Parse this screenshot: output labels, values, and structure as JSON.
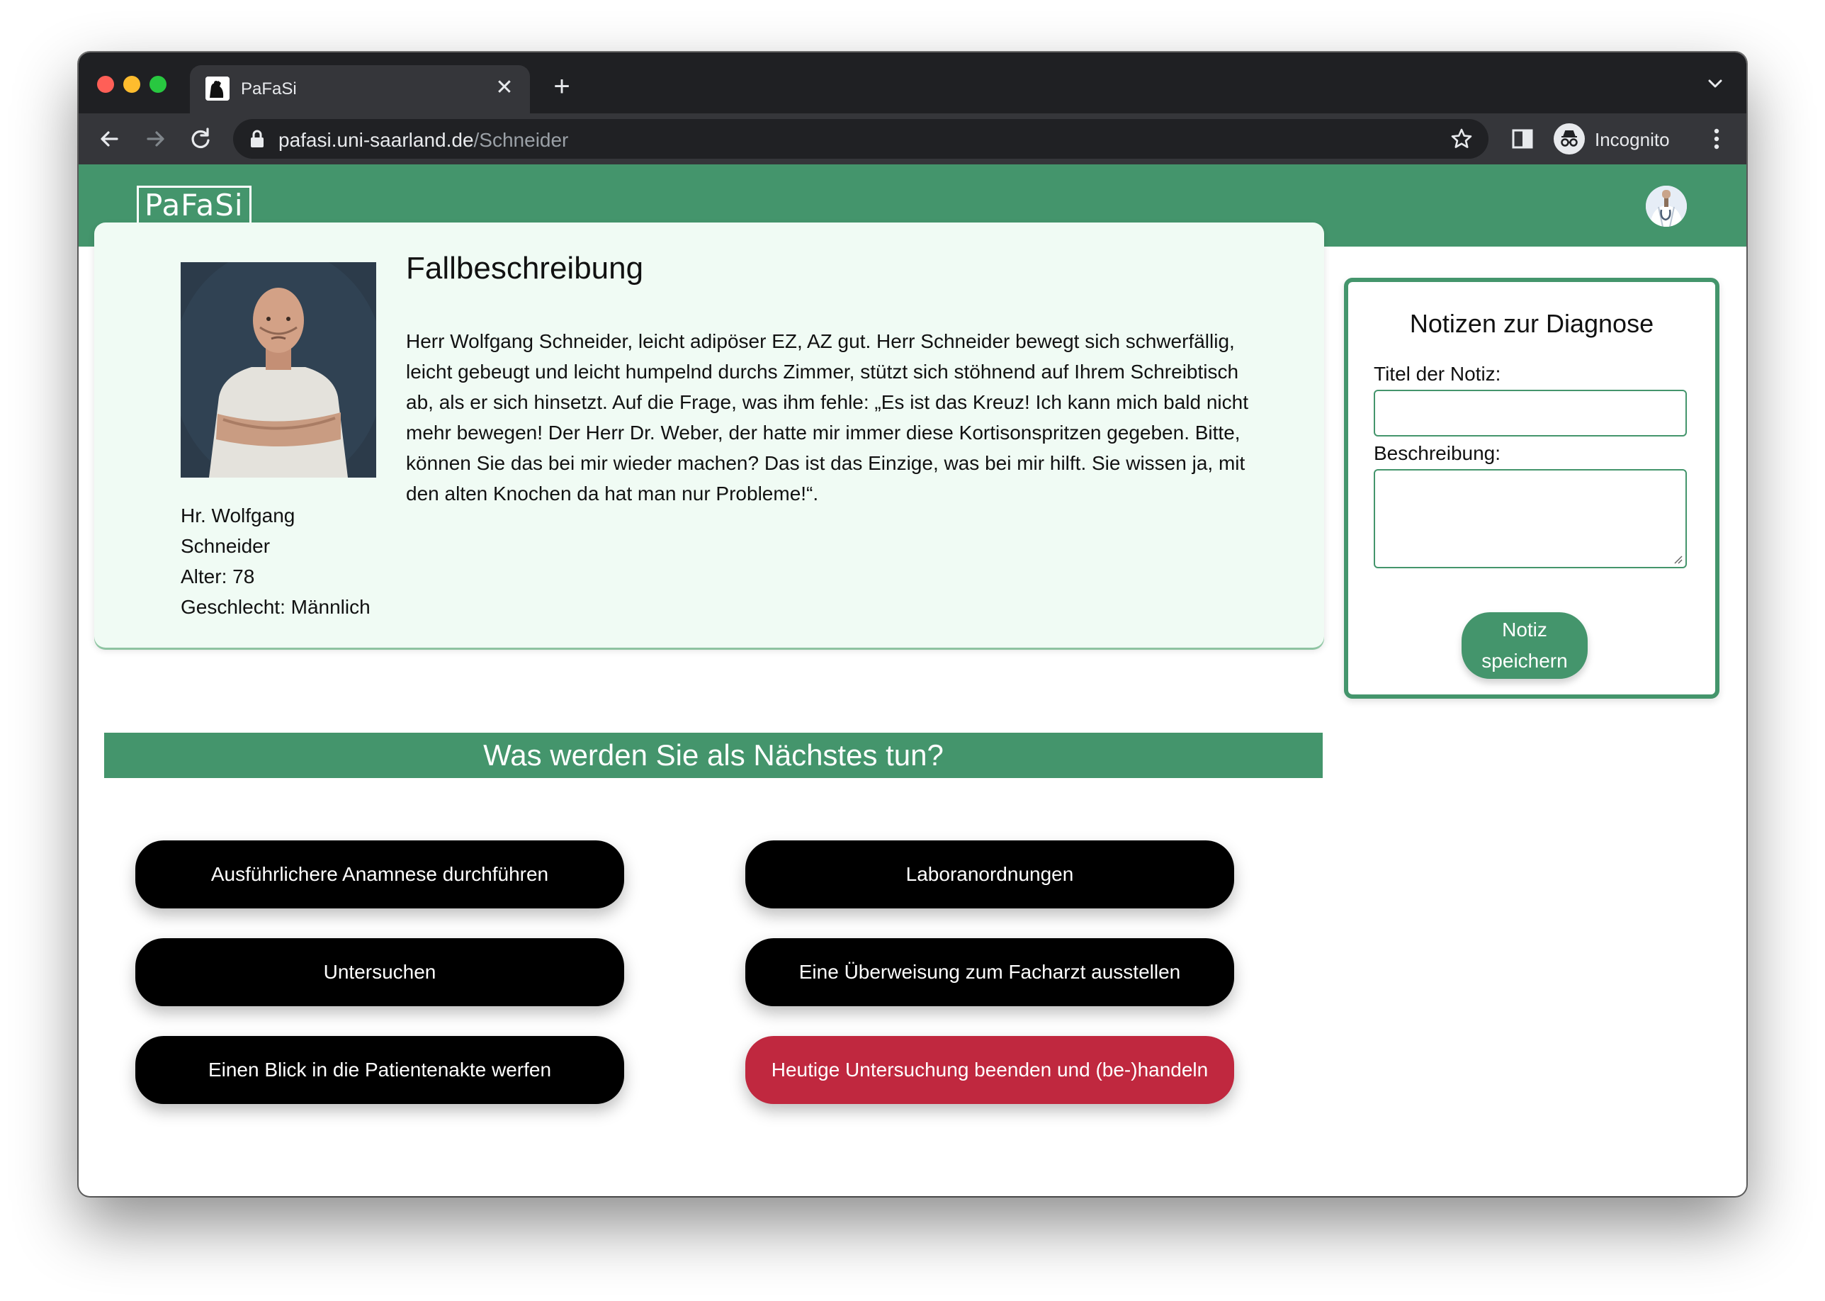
{
  "browser": {
    "tab_title": "PaFaSi",
    "url_host": "pafasi.uni-saarland.de",
    "url_path": "/Schneider",
    "incognito_label": "Incognito"
  },
  "app": {
    "logo": "PaFaSi",
    "accent_color": "#44956c",
    "danger_color": "#c0283f"
  },
  "patient": {
    "name_line1": "Hr. Wolfgang",
    "name_line2": "Schneider",
    "age": "Alter: 78",
    "gender": "Geschlecht: Männlich"
  },
  "case": {
    "heading": "Fallbeschreibung",
    "text": "Herr Wolfgang Schneider, leicht adipöser EZ, AZ gut. Herr Schneider bewegt sich schwerfällig, leicht gebeugt und leicht humpelnd durchs Zimmer, stützt sich stöhnend auf Ihrem Schreibtisch ab, als er sich hinsetzt. Auf die Frage, was ihm fehle: „Es ist das Kreuz! Ich kann mich bald nicht mehr bewegen! Der Herr Dr. Weber, der hatte mir immer diese Kortisonspritzen gegeben. Bitte, können Sie das bei mir wieder machen? Das ist das Einzige, was bei mir hilft. Sie wissen ja, mit den alten Knochen da hat man nur Probleme!“."
  },
  "notes": {
    "title": "Notizen zur Diagnose",
    "title_label": "Titel der Notiz:",
    "title_value": "",
    "description_label": "Beschreibung:",
    "description_value": "",
    "save_line1": "Notiz",
    "save_line2": "speichern"
  },
  "next_step": {
    "question": "Was werden Sie als Nächstes tun?",
    "actions": [
      "Ausführlichere Anamnese durchführen",
      "Laboranordnungen",
      "Untersuchen",
      "Eine Überweisung zum Facharzt ausstellen",
      "Einen Blick in die Patientenakte werfen",
      "Heutige Untersuchung beenden und (be-)handeln"
    ]
  }
}
